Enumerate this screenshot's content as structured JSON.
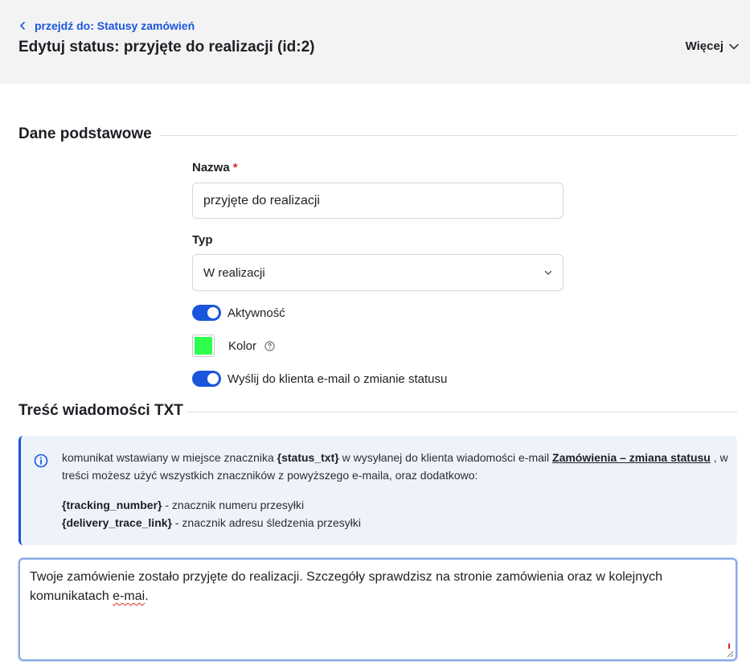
{
  "header": {
    "breadcrumb_label": "przejdź do: Statusy zamówień",
    "title": "Edytuj status: przyjęte do realizacji (id:2)",
    "more_label": "Więcej"
  },
  "basic_section": {
    "title": "Dane podstawowe",
    "name_label": "Nazwa",
    "required_mark": "*",
    "name_value": "przyjęte do realizacji",
    "type_label": "Typ",
    "type_value": "W realizacji",
    "active_label": "Aktywność",
    "active_on": true,
    "color_label": "Kolor",
    "color_value": "#2eff4c",
    "send_email_label": "Wyślij do klienta e-mail o zmianie statusu",
    "send_email_on": true
  },
  "txt_section": {
    "title": "Treść wiadomości TXT",
    "info": {
      "p1_a": "komunikat wstawiany w miejsce znacznika ",
      "tag_status": "{status_txt}",
      "p1_b": " w wysyłanej do klienta wiadomości e-mail ",
      "link": "Zamówienia – zmiana statusu",
      "p1_c": " , w treści możesz użyć wszystkich znaczników z powyższego e-maila, oraz dodatkowo:",
      "tag_tracking": "{tracking_number}",
      "tracking_desc": " - znacznik numeru przesyłki",
      "tag_delivery": "{delivery_trace_link}",
      "delivery_desc": " - znacznik adresu śledzenia przesyłki"
    },
    "message_main": "Twoje zamówienie zostało przyjęte do realizacji. Szczegóły sprawdzisz na stronie zamówienia oraz w kolejnych komunikatach ",
    "message_misspelled": "e-mai",
    "message_end": "."
  },
  "colors": {
    "accent": "#1a56db",
    "header_bg": "#f3f3f4",
    "info_bg": "#eef3fb",
    "required": "#d92d20"
  },
  "icons": {
    "breadcrumb": "chevron-left-icon",
    "more": "chevron-down-icon",
    "select": "chevron-down-icon",
    "help": "question-circle-icon",
    "info": "info-circle-icon",
    "resize": "resize-handle-icon"
  }
}
